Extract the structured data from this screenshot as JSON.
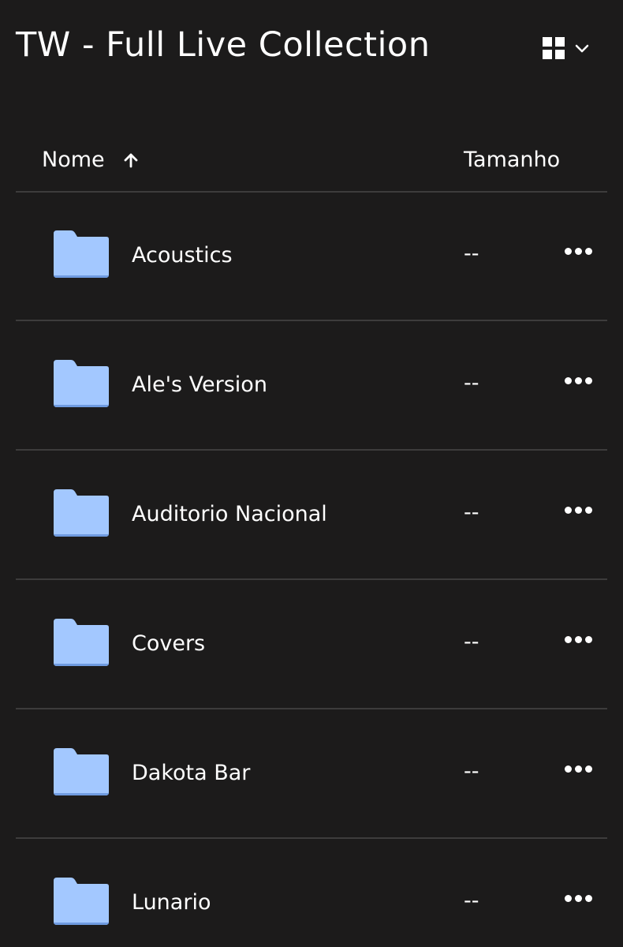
{
  "header": {
    "title": "TW - Full Live Collection",
    "view_icon": "grid-view-icon",
    "dropdown_icon": "chevron-down-icon"
  },
  "columns": {
    "name_label": "Nome",
    "sort_icon": "arrow-up-icon",
    "size_label": "Tamanho"
  },
  "items": [
    {
      "name": "Acoustics",
      "size": "--",
      "icon": "folder-icon"
    },
    {
      "name": "Ale's Version",
      "size": "--",
      "icon": "folder-icon"
    },
    {
      "name": "Auditorio Nacional",
      "size": "--",
      "icon": "folder-icon"
    },
    {
      "name": "Covers",
      "size": "--",
      "icon": "folder-icon"
    },
    {
      "name": "Dakota Bar",
      "size": "--",
      "icon": "folder-icon"
    },
    {
      "name": "Lunario",
      "size": "--",
      "icon": "folder-icon"
    }
  ],
  "colors": {
    "background": "#1c1b1b",
    "text": "#ffffff",
    "divider": "#3d3c3c",
    "folder": "#a3c8ff",
    "folder_edge": "#6f9be0"
  }
}
